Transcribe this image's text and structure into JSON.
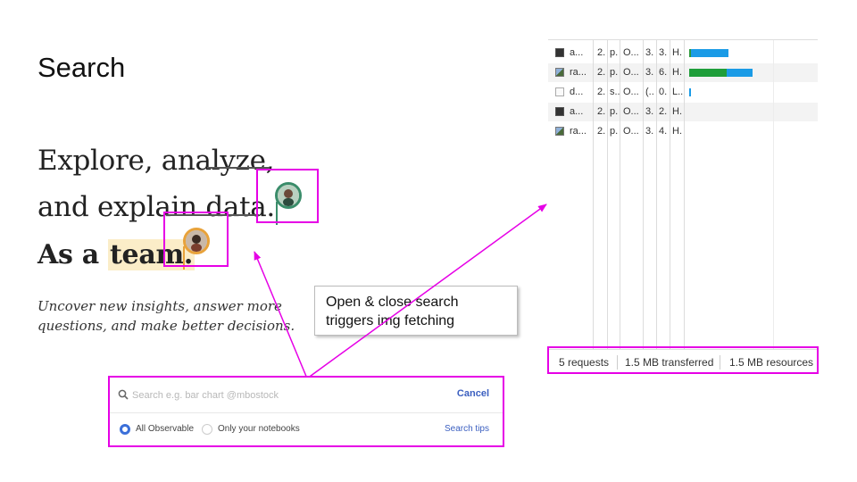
{
  "slide": {
    "title": "Search",
    "callout": {
      "line1": "Open & close search",
      "line2": "triggers img fetching"
    }
  },
  "hero": {
    "line1": "Explore, analyze,",
    "line2": "and explain data.",
    "line3_prefix": "As a ",
    "line3_highlight": "team.",
    "tagline1": "Uncover new insights, answer more",
    "tagline2": "questions, and make better decisions."
  },
  "search": {
    "placeholder": "Search e.g. bar chart @mbostock",
    "cancel_label": "Cancel",
    "options": [
      {
        "label": "All Observable",
        "selected": true
      },
      {
        "label": "Only your notebooks",
        "selected": false
      }
    ],
    "tips_label": "Search tips"
  },
  "network": {
    "rows": [
      {
        "name": "a...",
        "c2": "2.",
        "c3": "p.",
        "c4": "O...",
        "c5": "3.",
        "c6": "3.",
        "c7": "H.",
        "icon": "dark-image-icon",
        "waterfall": [
          {
            "color": "#2c9a3b",
            "start": 0.0,
            "end": 0.02
          },
          {
            "color": "#1a9be6",
            "start": 0.02,
            "end": 0.4
          }
        ]
      },
      {
        "name": "ra...",
        "c2": "2.",
        "c3": "p.",
        "c4": "O...",
        "c5": "3.",
        "c6": "6.",
        "c7": "H.",
        "icon": "image-icon",
        "waterfall": [
          {
            "color": "#1f9e3a",
            "start": 0.0,
            "end": 0.38
          },
          {
            "color": "#1a9be6",
            "start": 0.38,
            "end": 0.65
          }
        ]
      },
      {
        "name": "d...",
        "c2": "2.",
        "c3": "s..",
        "c4": "O...",
        "c5": "(..",
        "c6": "0.",
        "c7": "L..",
        "icon": "broken-file-icon",
        "waterfall": [
          {
            "color": "#1a9be6",
            "start": 0.0,
            "end": 0.02
          }
        ]
      },
      {
        "name": "a...",
        "c2": "2.",
        "c3": "p.",
        "c4": "O...",
        "c5": "3.",
        "c6": "2.",
        "c7": "H.",
        "icon": "dark-image-icon",
        "waterfall": []
      },
      {
        "name": "ra...",
        "c2": "2.",
        "c3": "p.",
        "c4": "O...",
        "c5": "3.",
        "c6": "4.",
        "c7": "H.",
        "icon": "image-icon",
        "waterfall": []
      }
    ],
    "footer": {
      "requests": "5 requests",
      "transferred": "1.5 MB transferred",
      "resources": "1.5 MB resources"
    }
  },
  "colors": {
    "highlight_box": "#e600e6",
    "arrow": "#e600e6",
    "link": "#3b5fc0",
    "team_highlight": "#fbedc8"
  }
}
